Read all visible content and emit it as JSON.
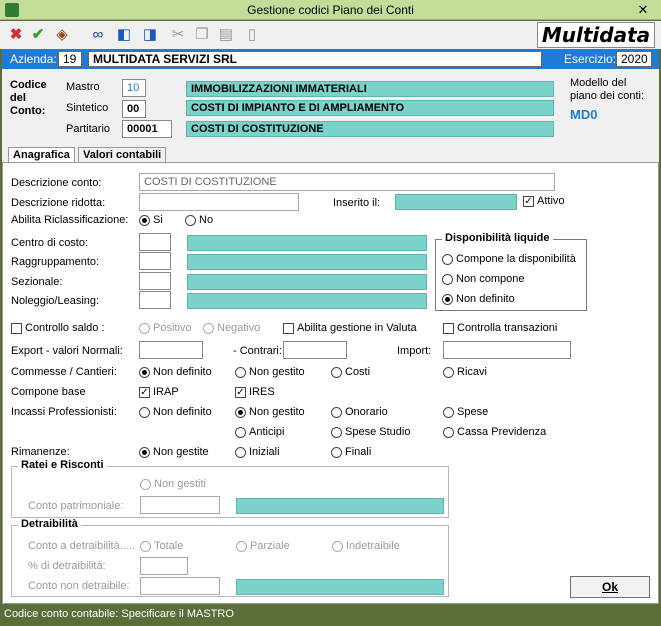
{
  "window": {
    "title": "Gestione codici Piano dei Conti"
  },
  "toolbar": {
    "icons": [
      "cancel-icon",
      "confirm-icon",
      "edit-icon",
      "binoculars-icon",
      "prev-icon",
      "next-icon",
      "cut-icon",
      "copy-icon",
      "paste-icon",
      "new-doc-icon"
    ]
  },
  "logo": {
    "text": "Multidata"
  },
  "azienda": {
    "label": "Azienda:",
    "code": "19",
    "name": "MULTIDATA SERVIZI SRL",
    "esercizio_label": "Esercizio:",
    "esercizio": "2020"
  },
  "conto": {
    "title_line1": "Codice",
    "title_line2": "del",
    "title_line3": "Conto:",
    "mastro_label": "Mastro",
    "mastro_value": "10",
    "mastro_desc": "IMMOBILIZZAZIONI IMMATERIALI",
    "sintetico_label": "Sintetico",
    "sintetico_value": "00",
    "sintetico_desc": "COSTI DI IMPIANTO E DI AMPLIAMENTO",
    "partitario_label": "Partitario",
    "partitario_value": "00001",
    "partitario_desc": "COSTI DI COSTITUZIONE",
    "modello_label1": "Modello del",
    "modello_label2": "piano dei conti:",
    "modello_value": "MD0"
  },
  "tabs": [
    {
      "label": "Anagrafica"
    },
    {
      "label": "Valori contabili"
    }
  ],
  "form": {
    "descrizione_label": "Descrizione conto:",
    "descrizione_value": "COSTI DI COSTITUZIONE",
    "ridotta_label": "Descrizione ridotta:",
    "ridotta_value": "",
    "inserito_label": "Inserito il:",
    "attivo_label": "Attivo",
    "riclass_label": "Abilita Riclassificazione:",
    "riclass_si": "Si",
    "riclass_no": "No",
    "centro_label": "Centro di costo:",
    "raggr_label": "Raggruppamento:",
    "sezionale_label": "Sezionale:",
    "noleggio_label": "Noleggio/Leasing:",
    "disp_title": "Disponibilità liquide",
    "disp_opt1": "Compone la disponibilità",
    "disp_opt2": "Non compone",
    "disp_opt3": "Non definito",
    "controllo_saldo": "Controllo saldo :",
    "positivo": "Positivo",
    "negativo": "Negativo",
    "abilita_valuta": "Abilita gestione in Valuta",
    "controlla_trans": "Controlla transazioni",
    "export_label": "Export - valori Normali:",
    "contrari_label": "- Contrari:",
    "import_label": "Import:",
    "commesse_label": "Commesse / Cantieri:",
    "comm_opt1": "Non definito",
    "comm_opt2": "Non gestito",
    "comm_opt3": "Costi",
    "comm_opt4": "Ricavi",
    "compone_label": "Compone base",
    "irap": "IRAP",
    "ires": "IRES",
    "incassi_label": "Incassi Professionisti:",
    "inc_opt1": "Non definito",
    "inc_opt2": "Non gestito",
    "inc_opt3": "Onorario",
    "inc_opt4": "Spese",
    "inc_opt5": "Anticipi",
    "inc_opt6": "Spese Studio",
    "inc_opt7": "Cassa Previdenza",
    "rimanenze_label": "Rimanenze:",
    "rim_opt1": "Non gestite",
    "rim_opt2": "Iniziali",
    "rim_opt3": "Finali",
    "ratei_title": "Ratei e Risconti",
    "ratei_opt": "Non gestiti",
    "conto_patr_label": "Conto patrimoniale:",
    "detr_title": "Detraibilità",
    "conto_detr_label": "Conto a detraibilità.....",
    "detr_opt1": "Totale",
    "detr_opt2": "Parziale",
    "detr_opt3": "Indetraibile",
    "perc_detr_label": "% di detraibilità:",
    "conto_non_detr_label": "Conto non detraibile:"
  },
  "ok_button": {
    "label": "Ok"
  },
  "status": {
    "text": "Codice conto contabile: Specificare il MASTRO"
  }
}
